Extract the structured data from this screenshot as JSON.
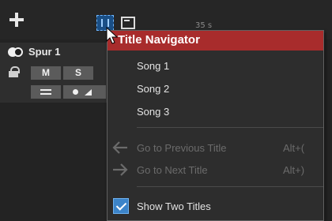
{
  "toolbar": {
    "add_icon": "plus-icon",
    "title_nav_icon": "title-navigator-icon",
    "window_icon": "window-icon",
    "ruler_label": "35 s"
  },
  "track": {
    "name": "Spur 1",
    "mute_label": "M",
    "solo_label": "S",
    "icons": {
      "toggle": "track-visibility-icon",
      "lock": "lock-icon",
      "fx": "fx-icon",
      "record": "record-icon"
    }
  },
  "menu": {
    "title": "Title Navigator",
    "header_color": "#a82c2c",
    "songs": [
      {
        "label": "Song 1"
      },
      {
        "label": "Song 2"
      },
      {
        "label": "Song 3"
      }
    ],
    "prev": {
      "label": "Go to Previous Title",
      "shortcut": "Alt+(",
      "icon": "arrow-left-icon",
      "enabled": false
    },
    "next": {
      "label": "Go to Next Title",
      "shortcut": "Alt+)",
      "icon": "arrow-right-icon",
      "enabled": false
    },
    "show_two": {
      "label": "Show Two Titles",
      "checked": true,
      "icon": "checkbox-checked-icon"
    }
  }
}
